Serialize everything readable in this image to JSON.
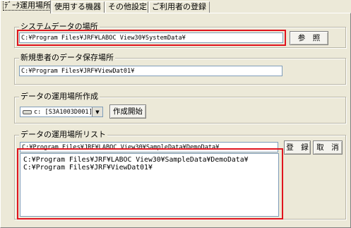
{
  "tabs": [
    {
      "label": "ﾃﾞｰﾀ運用場所"
    },
    {
      "label": "使用する機器"
    },
    {
      "label": "その他設定"
    },
    {
      "label": "ご利用者の登録"
    }
  ],
  "system_data": {
    "title": "システムデータの場所",
    "path": "C:¥Program Files¥JRF¥LABOC View30¥SystemData¥",
    "browse_label": "参　照"
  },
  "new_patient": {
    "title": "新規患者のデータ保存場所",
    "path": "C:¥Program Files¥JRF¥ViewDat01¥"
  },
  "create_location": {
    "title": "データの運用場所作成",
    "drive": "c: [S3A1003D001]",
    "start_label": "作成開始"
  },
  "location_list": {
    "title": "データの運用場所リスト",
    "input_value": "C:¥Program Files¥JRF¥LABOC View30¥SampleData¥DemoData¥",
    "register_label": "登　録",
    "cancel_label": "取　消",
    "items": [
      "C:¥Program Files¥JRF¥LABOC View30¥SampleData¥DemoData¥",
      "C:¥Program Files¥JRF¥ViewDat01¥"
    ]
  },
  "colors": {
    "highlight": "#e0141e",
    "dialog_bg": "#ece9d8"
  }
}
